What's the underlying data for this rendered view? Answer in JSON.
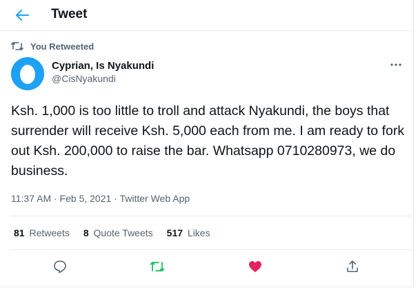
{
  "header": {
    "title": "Tweet",
    "back_icon": "arrow-left-icon"
  },
  "retweet": {
    "label": "You Retweeted",
    "icon": "retweet-icon"
  },
  "author": {
    "name": "Cyprian, Is Nyakundi",
    "handle": "@CisNyakundi",
    "avatar_color": "#1da1f2"
  },
  "tweet": {
    "text": "Ksh. 1,000 is too little to troll and attack Nyakundi, the boys that surrender will receive Ksh. 5,000 each from me. I am ready to fork out Ksh. 200,000 to raise the bar. Whatsapp 0710280973, we do business.",
    "time": "11:37 AM · Feb 5, 2021 · ",
    "source": "Twitter Web App"
  },
  "stats": {
    "retweets_count": "81",
    "retweets_label": "Retweets",
    "quotes_count": "8",
    "quotes_label": "Quote Tweets",
    "likes_count": "517",
    "likes_label": "Likes"
  },
  "colors": {
    "accent": "#1da1f2",
    "retweet_green": "#17bf63",
    "like_red": "#e0245e",
    "muted": "#536471"
  },
  "actions": [
    "reply-icon",
    "retweet-icon",
    "like-heart-icon",
    "share-icon"
  ]
}
